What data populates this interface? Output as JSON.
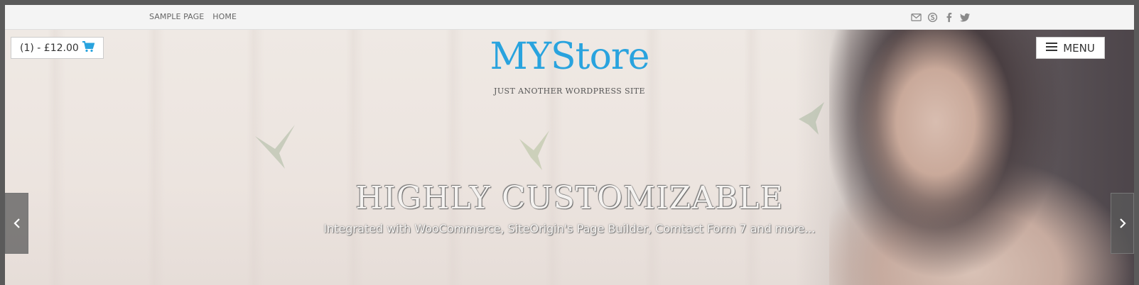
{
  "topnav": {
    "items": [
      "SAMPLE PAGE",
      "HOME"
    ]
  },
  "social": {
    "icons": [
      "email-icon",
      "skype-icon",
      "facebook-icon",
      "twitter-icon"
    ],
    "color": "#8a8a8a"
  },
  "cart": {
    "label": "(1) - £12.00",
    "icon": "cart-icon",
    "icon_color": "#29a3de"
  },
  "menu": {
    "label": "MENU",
    "icon": "hamburger-icon"
  },
  "site": {
    "title": "MYStore",
    "description": "JUST ANOTHER WORDPRESS SITE",
    "accent": "#29a3de"
  },
  "slider": {
    "title": "HIGHLY CUSTOMIZABLE",
    "text": "Integrated with WooCommerce, SiteOrigin's Page Builder, Comtact Form 7 and more..."
  }
}
